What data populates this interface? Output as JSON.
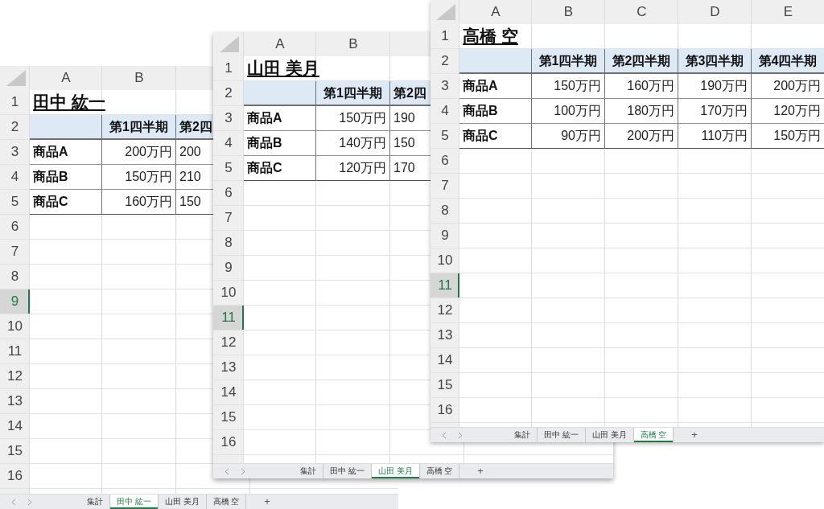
{
  "windows": [
    {
      "columns": [
        "A",
        "B"
      ],
      "title": "田中 紘一",
      "header": [
        "第1四半期",
        "第2四"
      ],
      "rows": [
        {
          "cells": [
            "商品A",
            "200万円",
            "200"
          ]
        },
        {
          "cells": [
            "商品B",
            "150万円",
            "210"
          ]
        },
        {
          "cells": [
            "商品C",
            "160万円",
            "150"
          ]
        }
      ],
      "row_headers": [
        {
          "label": "1",
          "selected": false
        },
        {
          "label": "2",
          "selected": false
        },
        {
          "label": "3",
          "selected": false
        },
        {
          "label": "4",
          "selected": false
        },
        {
          "label": "5",
          "selected": false
        },
        {
          "label": "6",
          "selected": false
        },
        {
          "label": "7",
          "selected": false
        },
        {
          "label": "8",
          "selected": false
        },
        {
          "label": "9",
          "selected": true
        },
        {
          "label": "10",
          "selected": false
        },
        {
          "label": "11",
          "selected": false
        },
        {
          "label": "12",
          "selected": false
        },
        {
          "label": "13",
          "selected": false
        },
        {
          "label": "14",
          "selected": false
        },
        {
          "label": "15",
          "selected": false
        },
        {
          "label": "16",
          "selected": false
        }
      ],
      "sheet_tabs": [
        {
          "label": "集計",
          "selected": false
        },
        {
          "label": "田中 紘一",
          "selected": true
        },
        {
          "label": "山田 美月",
          "selected": false
        },
        {
          "label": "高橋 空",
          "selected": false
        }
      ],
      "add_tab": "+"
    },
    {
      "columns": [
        "A",
        "B"
      ],
      "title": "山田 美月",
      "header": [
        "第1四半期",
        "第2四"
      ],
      "rows": [
        {
          "cells": [
            "商品A",
            "150万円",
            "190"
          ]
        },
        {
          "cells": [
            "商品B",
            "140万円",
            "150"
          ]
        },
        {
          "cells": [
            "商品C",
            "120万円",
            "170"
          ]
        }
      ],
      "row_headers": [
        {
          "label": "1",
          "selected": false
        },
        {
          "label": "2",
          "selected": false
        },
        {
          "label": "3",
          "selected": false
        },
        {
          "label": "4",
          "selected": false
        },
        {
          "label": "5",
          "selected": false
        },
        {
          "label": "6",
          "selected": false
        },
        {
          "label": "7",
          "selected": false
        },
        {
          "label": "8",
          "selected": false
        },
        {
          "label": "9",
          "selected": false
        },
        {
          "label": "10",
          "selected": false
        },
        {
          "label": "11",
          "selected": true
        },
        {
          "label": "12",
          "selected": false
        },
        {
          "label": "13",
          "selected": false
        },
        {
          "label": "14",
          "selected": false
        },
        {
          "label": "15",
          "selected": false
        },
        {
          "label": "16",
          "selected": false
        }
      ],
      "sheet_tabs": [
        {
          "label": "集計",
          "selected": false
        },
        {
          "label": "田中 紘一",
          "selected": false
        },
        {
          "label": "山田 美月",
          "selected": true
        },
        {
          "label": "高橋 空",
          "selected": false
        }
      ],
      "add_tab": "+"
    },
    {
      "columns": [
        "A",
        "B",
        "C",
        "D",
        "E"
      ],
      "title": "高橋 空",
      "header": [
        "第1四半期",
        "第2四半期",
        "第3四半期",
        "第4四半期"
      ],
      "rows": [
        {
          "cells": [
            "商品A",
            "150万円",
            "160万円",
            "190万円",
            "200万円"
          ]
        },
        {
          "cells": [
            "商品B",
            "100万円",
            "180万円",
            "170万円",
            "120万円"
          ]
        },
        {
          "cells": [
            "商品C",
            "90万円",
            "200万円",
            "110万円",
            "150万円"
          ]
        }
      ],
      "row_headers": [
        {
          "label": "1",
          "selected": false
        },
        {
          "label": "2",
          "selected": false
        },
        {
          "label": "3",
          "selected": false
        },
        {
          "label": "4",
          "selected": false
        },
        {
          "label": "5",
          "selected": false
        },
        {
          "label": "6",
          "selected": false
        },
        {
          "label": "7",
          "selected": false
        },
        {
          "label": "8",
          "selected": false
        },
        {
          "label": "9",
          "selected": false
        },
        {
          "label": "10",
          "selected": false
        },
        {
          "label": "11",
          "selected": true
        },
        {
          "label": "12",
          "selected": false
        },
        {
          "label": "13",
          "selected": false
        },
        {
          "label": "14",
          "selected": false
        },
        {
          "label": "15",
          "selected": false
        },
        {
          "label": "16",
          "selected": false
        }
      ],
      "sheet_tabs": [
        {
          "label": "集計",
          "selected": false
        },
        {
          "label": "田中 紘一",
          "selected": false
        },
        {
          "label": "山田 美月",
          "selected": false
        },
        {
          "label": "高橋 空",
          "selected": true
        }
      ],
      "add_tab": "+"
    }
  ]
}
